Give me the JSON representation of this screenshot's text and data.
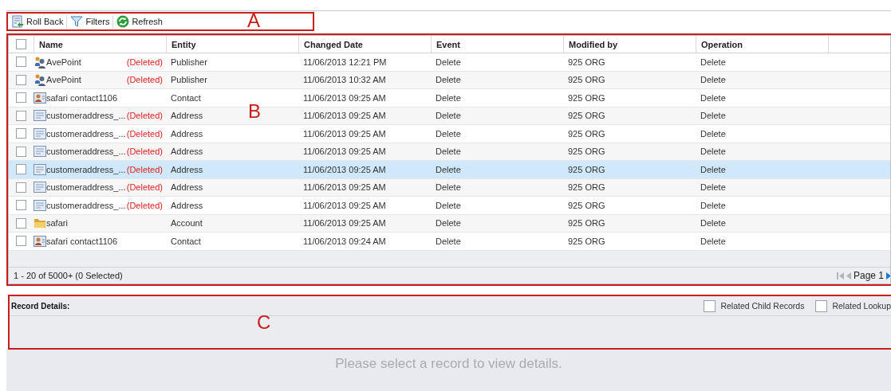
{
  "toolbar": [
    {
      "label": "Roll Back",
      "kind": "rollback"
    },
    {
      "label": "Filters",
      "kind": "filter"
    },
    {
      "label": "Refresh",
      "kind": "refresh"
    }
  ],
  "table": {
    "columns": [
      "Name",
      "Entity",
      "Changed Date",
      "Event",
      "Modified by",
      "Operation"
    ],
    "rows": [
      {
        "kind": "publisher",
        "name": "AvePoint",
        "deleted_tag": "(Deleted)",
        "entity": "Publisher",
        "changed_date": "11/06/2013 12:21 PM",
        "event": "Delete",
        "modified_by": "925 ORG",
        "operation": "Delete",
        "checked": false,
        "selected": false
      },
      {
        "kind": "publisher",
        "name": "AvePoint",
        "deleted_tag": "(Deleted)",
        "entity": "Publisher",
        "changed_date": "11/06/2013 10:32 AM",
        "event": "Delete",
        "modified_by": "925 ORG",
        "operation": "Delete",
        "checked": false,
        "selected": false
      },
      {
        "kind": "contact",
        "name": "safari contact1106",
        "entity": "Contact",
        "changed_date": "11/06/2013 09:25 AM",
        "event": "Delete",
        "modified_by": "925 ORG",
        "operation": "Delete",
        "checked": false,
        "selected": false
      },
      {
        "kind": "address",
        "name": "customeraddress_...",
        "deleted_tag": "(Deleted)",
        "entity": "Address",
        "changed_date": "11/06/2013 09:25 AM",
        "event": "Delete",
        "modified_by": "925 ORG",
        "operation": "Delete",
        "checked": false,
        "selected": false
      },
      {
        "kind": "address",
        "name": "customeraddress_...",
        "deleted_tag": "(Deleted)",
        "entity": "Address",
        "changed_date": "11/06/2013 09:25 AM",
        "event": "Delete",
        "modified_by": "925 ORG",
        "operation": "Delete",
        "checked": false,
        "selected": false
      },
      {
        "kind": "address",
        "name": "customeraddress_...",
        "deleted_tag": "(Deleted)",
        "entity": "Address",
        "changed_date": "11/06/2013 09:25 AM",
        "event": "Delete",
        "modified_by": "925 ORG",
        "operation": "Delete",
        "checked": false,
        "selected": false
      },
      {
        "kind": "address",
        "name": "customeraddress_...",
        "deleted_tag": "(Deleted)",
        "entity": "Address",
        "changed_date": "11/06/2013 09:25 AM",
        "event": "Delete",
        "modified_by": "925 ORG",
        "operation": "Delete",
        "checked": false,
        "selected": true
      },
      {
        "kind": "address",
        "name": "customeraddress_...",
        "deleted_tag": "(Deleted)",
        "entity": "Address",
        "changed_date": "11/06/2013 09:25 AM",
        "event": "Delete",
        "modified_by": "925 ORG",
        "operation": "Delete",
        "checked": false,
        "selected": false
      },
      {
        "kind": "address",
        "name": "customeraddress_...",
        "deleted_tag": "(Deleted)",
        "entity": "Address",
        "changed_date": "11/06/2013 09:25 AM",
        "event": "Delete",
        "modified_by": "925 ORG",
        "operation": "Delete",
        "checked": false,
        "selected": false
      },
      {
        "kind": "account",
        "name": "safari",
        "entity": "Account",
        "changed_date": "11/06/2013 09:25 AM",
        "event": "Delete",
        "modified_by": "925 ORG",
        "operation": "Delete",
        "checked": false,
        "selected": false
      },
      {
        "kind": "contact",
        "name": "safari contact1106",
        "entity": "Contact",
        "changed_date": "11/06/2013 09:24 AM",
        "event": "Delete",
        "modified_by": "925 ORG",
        "operation": "Delete",
        "checked": false,
        "selected": false
      }
    ],
    "header_checked": false,
    "status": "1 - 20  of 5000+  (0 Selected)",
    "page": "Page 1"
  },
  "record_details": {
    "title": "Record Details:",
    "options": [
      {
        "label": "Related Child Records",
        "checked": false
      },
      {
        "label": "Related Lookup",
        "checked": false
      }
    ]
  },
  "message": "Please select a record to view details.",
  "annotations": [
    {
      "label": "A"
    },
    {
      "label": "B"
    },
    {
      "label": "C"
    }
  ]
}
